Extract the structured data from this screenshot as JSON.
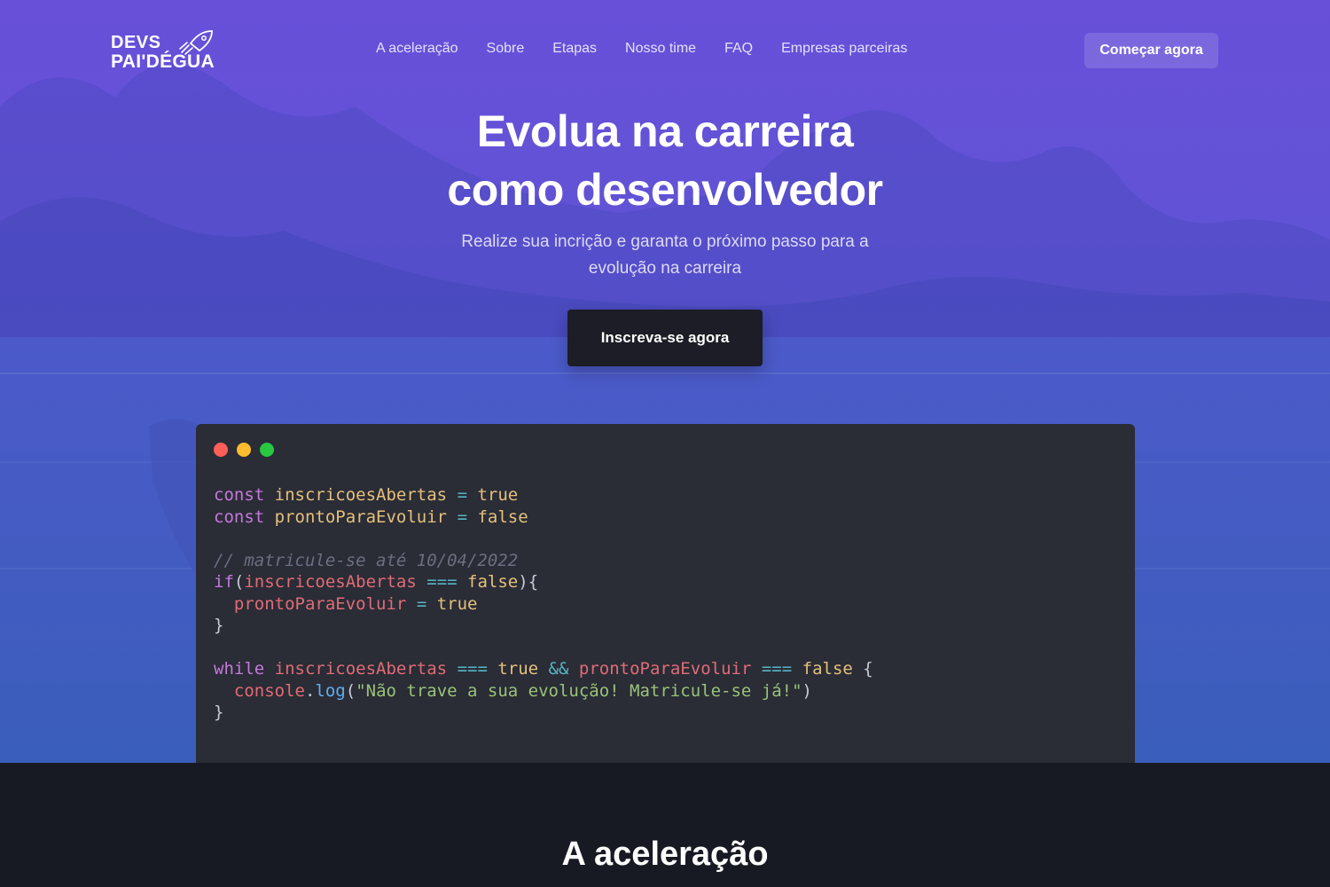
{
  "brand": {
    "line1": "DEVS",
    "line2": "PAI'DÉGUA"
  },
  "nav": {
    "items": [
      "A aceleração",
      "Sobre",
      "Etapas",
      "Nosso time",
      "FAQ",
      "Empresas parceiras"
    ],
    "cta": "Começar agora"
  },
  "hero": {
    "title_line1": "Evolua na carreira",
    "title_line2": "como desenvolvedor",
    "subtitle_line1": "Realize sua incrição e garanta o próximo passo para a",
    "subtitle_line2": "evolução na carreira",
    "cta": "Inscreva-se agora"
  },
  "code": {
    "kw_const": "const",
    "kw_if": "if",
    "kw_while": "while",
    "var_inscricoes": "inscricoesAbertas",
    "var_pronto": "prontoParaEvoluir",
    "true": "true",
    "false": "false",
    "comment": "// matricule-se até 10/04/2022",
    "console": "console",
    "log": "log",
    "message": "\"Não trave a sua evolução! Matricule-se já!\""
  },
  "section": {
    "title": "A aceleração"
  },
  "colors": {
    "hero_top": "#5d4fd6",
    "hero_bottom": "#3a5aba",
    "page_bg": "#181a23",
    "code_bg": "#2a2c36",
    "button_dark": "#1c1d26"
  },
  "icons": {
    "logo": "rocket-icon"
  }
}
